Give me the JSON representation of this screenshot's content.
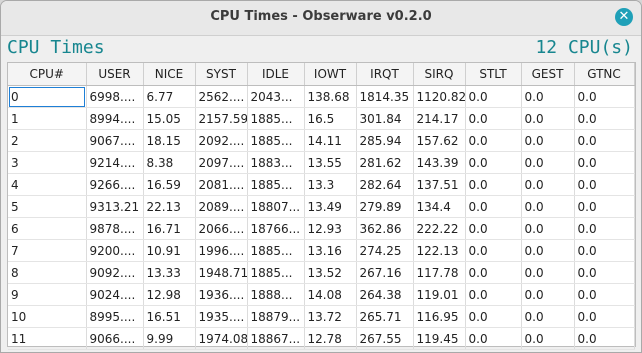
{
  "window": {
    "title": "CPU Times - Obserware v0.2.0"
  },
  "header": {
    "left": "CPU Times",
    "right": "12 CPU(s)"
  },
  "table": {
    "columns": [
      "CPU#",
      "USER",
      "NICE",
      "SYST",
      "IDLE",
      "IOWT",
      "IRQT",
      "SIRQ",
      "STLT",
      "GEST",
      "GTNC"
    ],
    "rows": [
      [
        "0",
        "6998....",
        "6.77",
        "2562....",
        "2043...",
        "138.68",
        "1814.35",
        "1120.82",
        "0.0",
        "0.0",
        "0.0"
      ],
      [
        "1",
        "8994....",
        "15.05",
        "2157.59",
        "1885...",
        "16.5",
        "301.84",
        "214.17",
        "0.0",
        "0.0",
        "0.0"
      ],
      [
        "2",
        "9067....",
        "18.15",
        "2092....",
        "1885...",
        "14.11",
        "285.94",
        "157.62",
        "0.0",
        "0.0",
        "0.0"
      ],
      [
        "3",
        "9214....",
        "8.38",
        "2097....",
        "1883...",
        "13.55",
        "281.62",
        "143.39",
        "0.0",
        "0.0",
        "0.0"
      ],
      [
        "4",
        "9266....",
        "16.59",
        "2081....",
        "1885...",
        "13.3",
        "282.64",
        "137.51",
        "0.0",
        "0.0",
        "0.0"
      ],
      [
        "5",
        "9313.21",
        "22.13",
        "2089....",
        "18807...",
        "13.49",
        "279.89",
        "134.4",
        "0.0",
        "0.0",
        "0.0"
      ],
      [
        "6",
        "9878....",
        "16.71",
        "2066....",
        "18766...",
        "12.93",
        "362.86",
        "222.22",
        "0.0",
        "0.0",
        "0.0"
      ],
      [
        "7",
        "9200....",
        "10.91",
        "1996....",
        "1885...",
        "13.16",
        "274.25",
        "122.13",
        "0.0",
        "0.0",
        "0.0"
      ],
      [
        "8",
        "9092....",
        "13.33",
        "1948.71",
        "1885...",
        "13.52",
        "267.16",
        "117.78",
        "0.0",
        "0.0",
        "0.0"
      ],
      [
        "9",
        "9024....",
        "12.98",
        "1936....",
        "1888...",
        "14.08",
        "264.38",
        "119.01",
        "0.0",
        "0.0",
        "0.0"
      ],
      [
        "10",
        "8995....",
        "16.51",
        "1935....",
        "18879...",
        "13.72",
        "265.71",
        "116.95",
        "0.0",
        "0.0",
        "0.0"
      ],
      [
        "11",
        "9066....",
        "9.99",
        "1974.08",
        "18867...",
        "12.78",
        "267.55",
        "119.45",
        "0.0",
        "0.0",
        "0.0"
      ]
    ]
  },
  "colors": {
    "accent": "#17868f",
    "close_button": "#1fa0b8",
    "selection": "#1e7fd6"
  }
}
